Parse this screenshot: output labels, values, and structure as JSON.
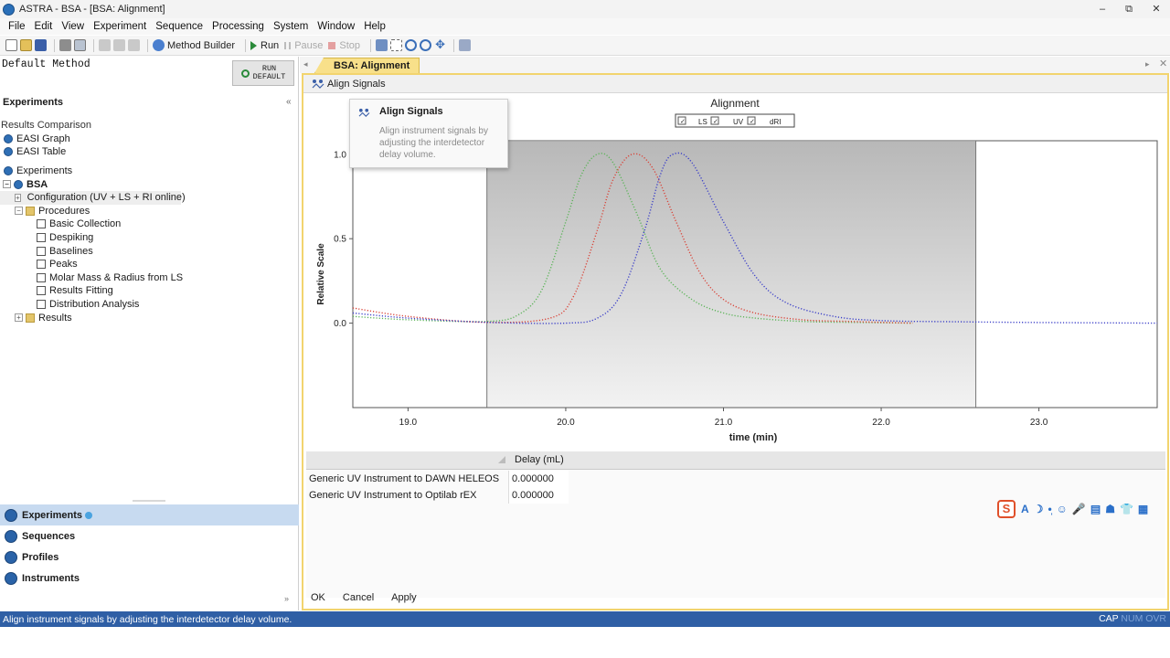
{
  "window": {
    "title": "ASTRA - BSA - [BSA: Alignment]",
    "controls": [
      "–",
      "⧉",
      "✕"
    ]
  },
  "menu": [
    "File",
    "Edit",
    "View",
    "Experiment",
    "Sequence",
    "Processing",
    "System",
    "Window",
    "Help"
  ],
  "toolbar": {
    "method_builder": "Method Builder",
    "run": "Run",
    "pause": "Pause",
    "stop": "Stop"
  },
  "left": {
    "default_method": "Default Method",
    "run_default_line1": "RUN",
    "run_default_line2": "DEFAULT",
    "section_title": "Experiments",
    "collapse": "«",
    "results_comparison": "Results Comparison",
    "easi_graph": "EASI Graph",
    "easi_table": "EASI Table",
    "experiments_root": "Experiments",
    "bsa": "BSA",
    "configuration": "Configuration (UV + LS + RI online)",
    "procedures": "Procedures",
    "procedure_items": [
      "Basic Collection",
      "Despiking",
      "Baselines",
      "Peaks",
      "Molar Mass & Radius from LS",
      "Results Fitting",
      "Distribution Analysis"
    ],
    "results": "Results",
    "nav": [
      "Experiments",
      "Sequences",
      "Profiles",
      "Instruments"
    ],
    "nav_more": "»"
  },
  "document": {
    "tab": "BSA: Alignment",
    "align_button": "Align Signals",
    "tooltip": {
      "title": "Align Signals",
      "body": "Align instrument signals by adjusting the interdetector delay volume."
    }
  },
  "delay_table": {
    "header": "Delay (mL)",
    "rows": [
      {
        "label": "Generic UV Instrument to DAWN HELEOS",
        "value": "0.000000"
      },
      {
        "label": "Generic UV Instrument to Optilab rEX",
        "value": "0.000000"
      }
    ]
  },
  "buttons": {
    "ok": "OK",
    "cancel": "Cancel",
    "apply": "Apply"
  },
  "ime_toolbar": {
    "logo": "S",
    "glyphs": [
      "A",
      "☽",
      "•̩",
      "☺",
      "🎤",
      "▤",
      "☗",
      "👕",
      "▦"
    ]
  },
  "status": {
    "text": "Align instrument signals by adjusting the interdetector delay volume.",
    "cap": "CAP",
    "num_ovr": "NUM OVR"
  },
  "colors": {
    "ls": "#d9453a",
    "uv": "#5db45a",
    "dri": "#3b3fc8",
    "status_bar": "#2f5fa5",
    "tab": "#f8e08a"
  },
  "chart_data": {
    "type": "line",
    "title": "Alignment",
    "xlabel": "time (min)",
    "ylabel": "Relative Scale",
    "xlim": [
      18.65,
      23.75
    ],
    "ylim": [
      -0.5,
      1.08
    ],
    "xticks": [
      19.0,
      20.0,
      21.0,
      22.0,
      23.0
    ],
    "xtick_labels": [
      "19.0",
      "20.0",
      "21.0",
      "22.0",
      "23.0"
    ],
    "yticks": [
      0.0,
      0.5,
      1.0
    ],
    "ytick_labels": [
      "0.0",
      "0.5",
      "1.0"
    ],
    "shaded_region": [
      19.5,
      22.6
    ],
    "legend": {
      "placement": "top-center",
      "entries": [
        "LS",
        "UV",
        "dRI"
      ]
    },
    "series": [
      {
        "name": "UV",
        "color": "#5db45a",
        "x": [
          18.65,
          19.0,
          19.5,
          19.7,
          19.85,
          20.0,
          20.1,
          20.2,
          20.3,
          20.45,
          20.6,
          20.8,
          21.0,
          21.2,
          21.5,
          21.8,
          22.2
        ],
        "y": [
          0.04,
          0.02,
          0.01,
          0.05,
          0.2,
          0.6,
          0.88,
          1.0,
          0.95,
          0.65,
          0.32,
          0.14,
          0.06,
          0.03,
          0.01,
          0.005,
          0.0
        ]
      },
      {
        "name": "LS",
        "color": "#d9453a",
        "x": [
          18.65,
          19.0,
          19.5,
          19.9,
          20.05,
          20.2,
          20.3,
          20.42,
          20.55,
          20.7,
          20.85,
          21.0,
          21.2,
          21.5,
          21.8,
          22.2
        ],
        "y": [
          0.09,
          0.04,
          0.005,
          0.03,
          0.16,
          0.55,
          0.85,
          1.0,
          0.92,
          0.6,
          0.3,
          0.14,
          0.06,
          0.02,
          0.01,
          0.0
        ]
      },
      {
        "name": "dRI",
        "color": "#3b3fc8",
        "x": [
          18.65,
          19.0,
          19.5,
          20.0,
          20.2,
          20.35,
          20.5,
          20.6,
          20.68,
          20.8,
          21.0,
          21.2,
          21.4,
          21.7,
          22.0,
          22.5,
          23.0,
          23.75
        ],
        "y": [
          0.06,
          0.03,
          0.005,
          0.0,
          0.03,
          0.17,
          0.55,
          0.88,
          1.0,
          0.95,
          0.6,
          0.28,
          0.12,
          0.04,
          0.015,
          0.008,
          0.004,
          0.0
        ]
      }
    ]
  }
}
